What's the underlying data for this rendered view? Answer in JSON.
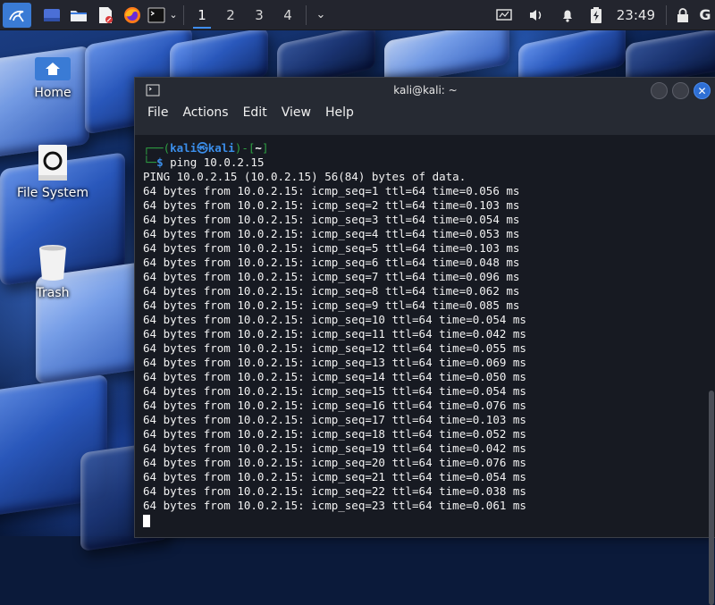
{
  "panel": {
    "workspaces": [
      "1",
      "2",
      "3",
      "4"
    ],
    "active_workspace": 0,
    "clock": "23:49",
    "tray_g": "G"
  },
  "desktop": {
    "icons": [
      {
        "label": "Home",
        "icon": "home-folder-icon"
      },
      {
        "label": "File System",
        "icon": "drive-icon"
      },
      {
        "label": "Trash",
        "icon": "trash-icon"
      }
    ]
  },
  "terminal": {
    "title": "kali@kali: ~",
    "menu": [
      "File",
      "Edit",
      "View",
      "Help"
    ],
    "menu_with_actions": [
      "File",
      "Actions",
      "Edit",
      "View",
      "Help"
    ],
    "prompt": {
      "user": "kali",
      "at": "㉿",
      "host": "kali",
      "dir": "~",
      "command": "ping 10.0.2.15"
    },
    "output": [
      "PING 10.0.2.15 (10.0.2.15) 56(84) bytes of data.",
      "64 bytes from 10.0.2.15: icmp_seq=1 ttl=64 time=0.056 ms",
      "64 bytes from 10.0.2.15: icmp_seq=2 ttl=64 time=0.103 ms",
      "64 bytes from 10.0.2.15: icmp_seq=3 ttl=64 time=0.054 ms",
      "64 bytes from 10.0.2.15: icmp_seq=4 ttl=64 time=0.053 ms",
      "64 bytes from 10.0.2.15: icmp_seq=5 ttl=64 time=0.103 ms",
      "64 bytes from 10.0.2.15: icmp_seq=6 ttl=64 time=0.048 ms",
      "64 bytes from 10.0.2.15: icmp_seq=7 ttl=64 time=0.096 ms",
      "64 bytes from 10.0.2.15: icmp_seq=8 ttl=64 time=0.062 ms",
      "64 bytes from 10.0.2.15: icmp_seq=9 ttl=64 time=0.085 ms",
      "64 bytes from 10.0.2.15: icmp_seq=10 ttl=64 time=0.054 ms",
      "64 bytes from 10.0.2.15: icmp_seq=11 ttl=64 time=0.042 ms",
      "64 bytes from 10.0.2.15: icmp_seq=12 ttl=64 time=0.055 ms",
      "64 bytes from 10.0.2.15: icmp_seq=13 ttl=64 time=0.069 ms",
      "64 bytes from 10.0.2.15: icmp_seq=14 ttl=64 time=0.050 ms",
      "64 bytes from 10.0.2.15: icmp_seq=15 ttl=64 time=0.054 ms",
      "64 bytes from 10.0.2.15: icmp_seq=16 ttl=64 time=0.076 ms",
      "64 bytes from 10.0.2.15: icmp_seq=17 ttl=64 time=0.103 ms",
      "64 bytes from 10.0.2.15: icmp_seq=18 ttl=64 time=0.052 ms",
      "64 bytes from 10.0.2.15: icmp_seq=19 ttl=64 time=0.042 ms",
      "64 bytes from 10.0.2.15: icmp_seq=20 ttl=64 time=0.076 ms",
      "64 bytes from 10.0.2.15: icmp_seq=21 ttl=64 time=0.054 ms",
      "64 bytes from 10.0.2.15: icmp_seq=22 ttl=64 time=0.038 ms",
      "64 bytes from 10.0.2.15: icmp_seq=23 ttl=64 time=0.061 ms"
    ]
  },
  "colors": {
    "accent": "#3e8df1",
    "prompt_green": "#2ea043",
    "prompt_blue": "#3b8eea",
    "panel_bg": "#23252e",
    "terminal_bg": "#161921"
  }
}
